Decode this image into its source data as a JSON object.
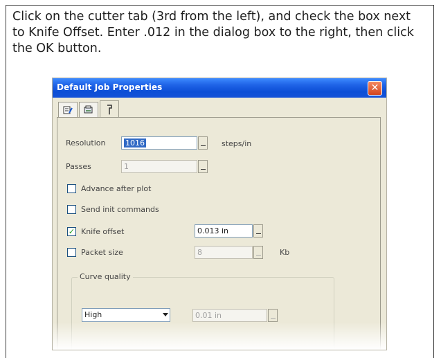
{
  "instructions": "Click on the cutter tab (3rd from the left), and check the box next to Knife Offset. Enter .012 in the dialog box to the right, then click the OK button.",
  "dialog": {
    "title": "Default Job Properties",
    "close_glyph": "✕",
    "tabs": [
      {
        "icon": "general-settings-icon",
        "active": false
      },
      {
        "icon": "plotter-icon",
        "active": false
      },
      {
        "icon": "cutter-icon",
        "active": true
      }
    ],
    "resolution": {
      "label": "Resolution",
      "value": "1016",
      "unit": "steps/in"
    },
    "passes": {
      "label": "Passes",
      "value": "1"
    },
    "advance_after_plot": {
      "label": "Advance after plot",
      "checked": false
    },
    "send_init_commands": {
      "label": "Send init commands",
      "checked": false
    },
    "knife_offset": {
      "label": "Knife offset",
      "checked": true,
      "value": "0.013 in"
    },
    "packet_size": {
      "label": "Packet size",
      "checked": false,
      "value": "8",
      "unit": "Kb"
    },
    "curve_quality": {
      "label": "Curve quality",
      "selected": "High",
      "value": "0.01 in"
    }
  }
}
